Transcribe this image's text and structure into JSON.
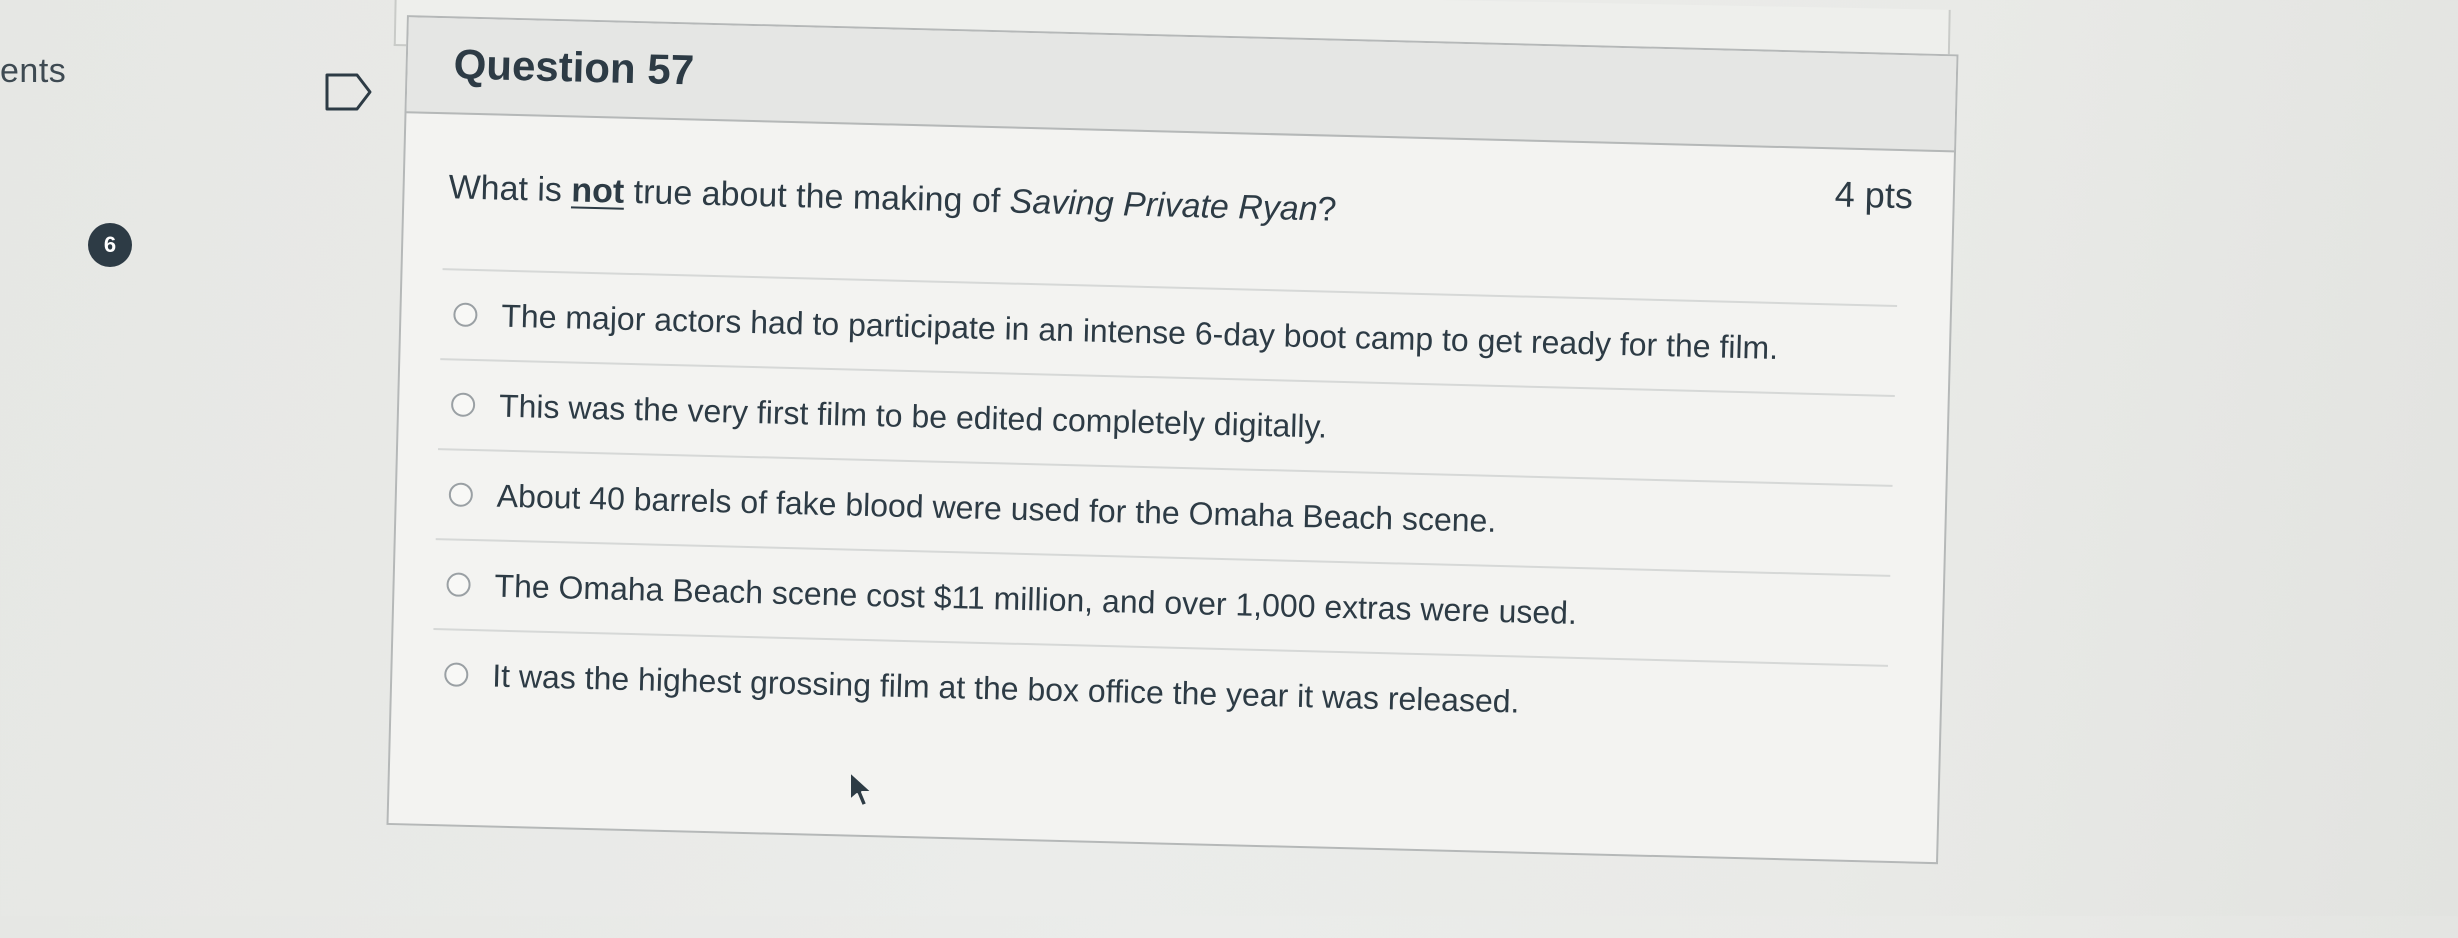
{
  "sidebar": {
    "cut_text": "ents",
    "question_badge": "6"
  },
  "question": {
    "title": "Question 57",
    "points": "4 pts",
    "text_before": "What is ",
    "text_emphasis": "not",
    "text_middle": " true about the making of ",
    "text_film": "Saving Private Ryan",
    "text_end": "?",
    "answers": [
      {
        "label": "The major actors had to participate in an intense 6-day boot camp to get ready for the film."
      },
      {
        "label": "This was the very first film to be edited completely digitally."
      },
      {
        "label": "About 40 barrels of fake blood were used for the Omaha Beach scene."
      },
      {
        "label": "The Omaha Beach scene cost $11 million, and over 1,000 extras were used."
      },
      {
        "label": "It was the highest grossing film at the box office the year it was released."
      }
    ]
  },
  "icons": {
    "bookmark": "bookmark-flag-icon",
    "cursor": "mouse-pointer-icon",
    "radio": "radio-button-icon"
  },
  "colors": {
    "text": "#2d3b45",
    "card_background": "#f3f3f1",
    "header_background": "#e5e6e4",
    "border": "#b5b8b8"
  }
}
